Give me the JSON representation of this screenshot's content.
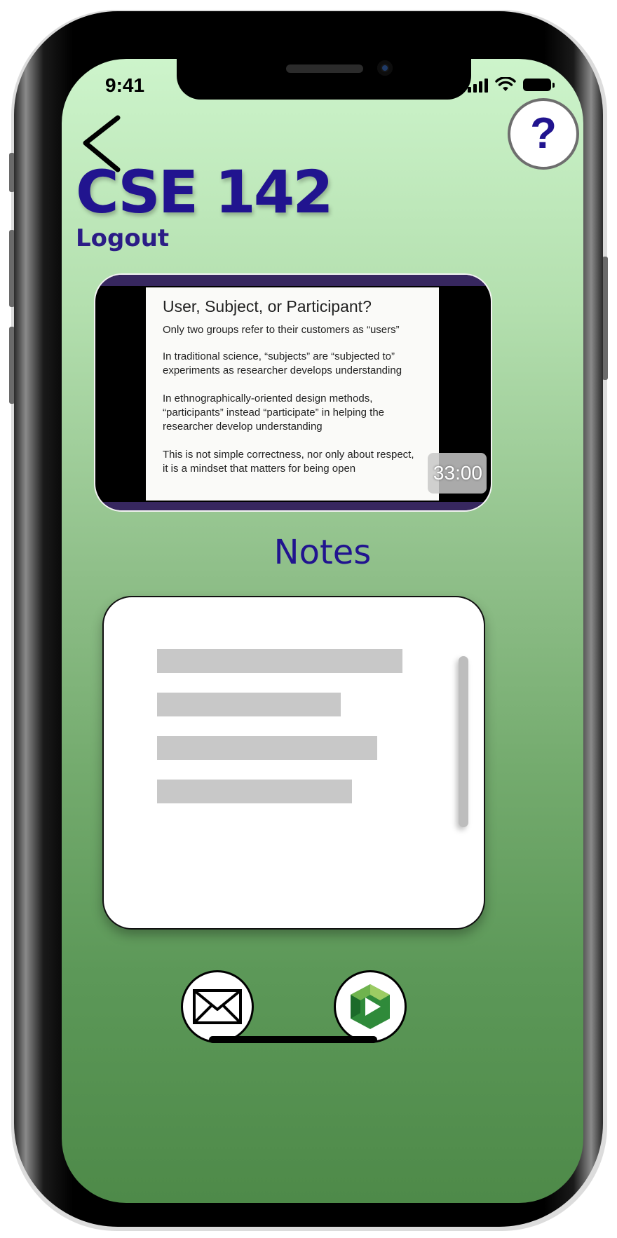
{
  "status_bar": {
    "time": "9:41"
  },
  "header": {
    "course_title": "CSE 142",
    "logout_label": "Logout",
    "help_label": "?"
  },
  "video": {
    "slide_title": "User, Subject, or Participant?",
    "slide_lines": [
      "Only two groups refer to their customers as “users”",
      "In traditional science, “subjects” are “subjected to” experiments as researcher develops understanding",
      "In ethnographically-oriented design methods, “participants” instead “participate” in helping the researcher develop understanding",
      "This is not simple correctness, nor only about respect, it is a mindset that matters for being open"
    ],
    "duration": "33:00"
  },
  "notes": {
    "heading": "Notes"
  },
  "bottom_nav": {
    "icons": [
      "mail-icon",
      "panopto-play-icon"
    ]
  },
  "colors": {
    "accent": "#21148f",
    "background_top": "#cdf4cb",
    "background_bottom": "#4e8a49"
  }
}
